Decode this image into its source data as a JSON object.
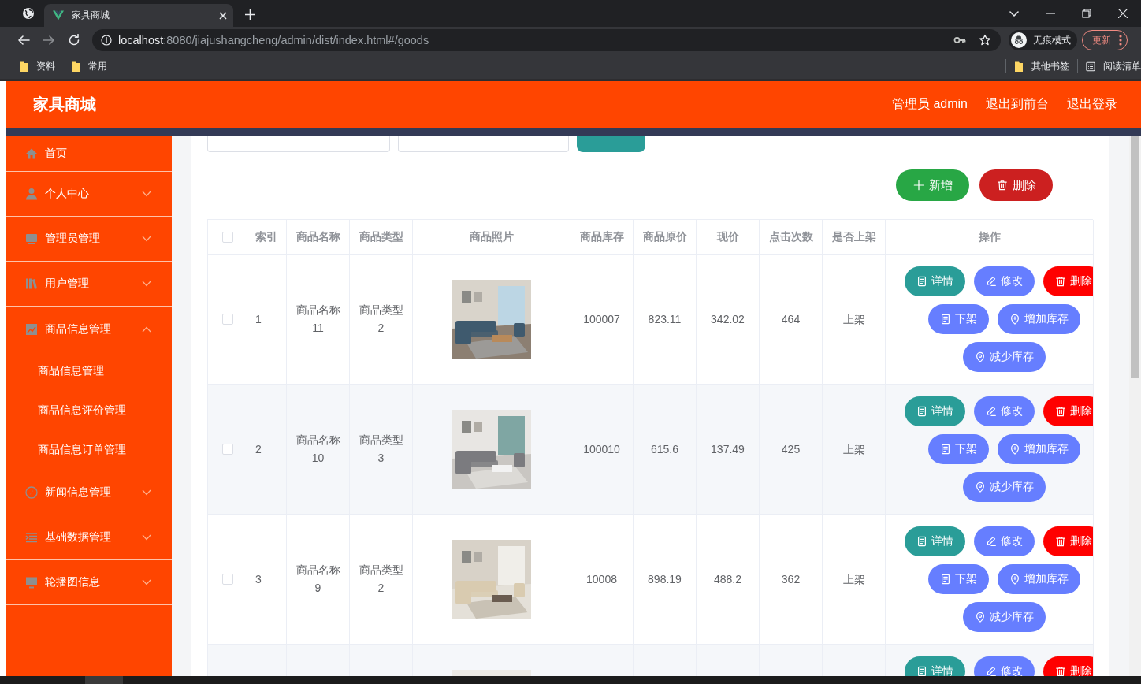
{
  "browser": {
    "tabs": [
      {
        "title": "家具商城",
        "selected": true
      }
    ],
    "url": {
      "host": "localhost",
      "path": ":8080/jiajushangcheng/admin/dist/index.html#/goods"
    },
    "profile": "无痕模式",
    "update_button": "更新",
    "bookmarks": [
      {
        "label": "资料"
      },
      {
        "label": "常用"
      }
    ],
    "bookmarks_right": [
      {
        "label": "其他书签",
        "kind": "folder"
      },
      {
        "label": "阅读清单",
        "kind": "reading-list"
      }
    ]
  },
  "header": {
    "title": "家具商城",
    "links": [
      "管理员 admin",
      "退出到前台",
      "退出登录"
    ]
  },
  "sidebar": {
    "items": [
      {
        "label": "首页"
      },
      {
        "label": "个人中心",
        "expanded": false
      },
      {
        "label": "管理员管理",
        "expanded": false
      },
      {
        "label": "用户管理",
        "expanded": false
      },
      {
        "label": "商品信息管理",
        "expanded": true,
        "children": [
          {
            "label": "商品信息管理"
          },
          {
            "label": "商品信息评价管理"
          },
          {
            "label": "商品信息订单管理"
          }
        ]
      },
      {
        "label": "新闻信息管理",
        "expanded": false
      },
      {
        "label": "基础数据管理",
        "expanded": false
      },
      {
        "label": "轮播图信息",
        "expanded": false
      }
    ]
  },
  "toolbar": {
    "buttons": [
      {
        "label": "新增",
        "kind": "add"
      },
      {
        "label": "删除",
        "kind": "delete"
      }
    ]
  },
  "table": {
    "select_all_checked": false,
    "columns": [
      "索引",
      "商品名称",
      "商品类型",
      "商品照片",
      "商品库存",
      "商品原价",
      "现价",
      "点击次数",
      "是否上架",
      "操作"
    ],
    "rows": [
      {
        "checked": false,
        "index": "1",
        "name": "商品名称11",
        "type": "商品类型2",
        "photo": {
          "kind": "picture"
        },
        "stock": "100007",
        "original_price": "823.11",
        "price": "342.02",
        "clicks": "464",
        "on_shelf": "上架",
        "actions": [
          {
            "label": "详情",
            "kind": "detail"
          },
          {
            "label": "修改",
            "kind": "edit"
          },
          {
            "label": "删除",
            "kind": "delete"
          },
          {
            "label": "下架",
            "kind": "unshelve"
          },
          {
            "label": "增加库存",
            "kind": "add-stock"
          },
          {
            "label": "减少库存",
            "kind": "reduce-stock"
          }
        ]
      },
      {
        "checked": false,
        "index": "2",
        "name": "商品名称10",
        "type": "商品类型3",
        "photo": {
          "kind": "picture"
        },
        "stock": "100010",
        "original_price": "615.6",
        "price": "137.49",
        "clicks": "425",
        "on_shelf": "上架",
        "actions": [
          {
            "label": "详情",
            "kind": "detail"
          },
          {
            "label": "修改",
            "kind": "edit"
          },
          {
            "label": "删除",
            "kind": "delete"
          },
          {
            "label": "下架",
            "kind": "unshelve"
          },
          {
            "label": "增加库存",
            "kind": "add-stock"
          },
          {
            "label": "减少库存",
            "kind": "reduce-stock"
          }
        ]
      },
      {
        "checked": false,
        "index": "3",
        "name": "商品名称9",
        "type": "商品类型2",
        "photo": {
          "kind": "picture"
        },
        "stock": "10008",
        "original_price": "898.19",
        "price": "488.2",
        "clicks": "362",
        "on_shelf": "上架",
        "actions": [
          {
            "label": "详情",
            "kind": "detail"
          },
          {
            "label": "修改",
            "kind": "edit"
          },
          {
            "label": "删除",
            "kind": "delete"
          },
          {
            "label": "下架",
            "kind": "unshelve"
          },
          {
            "label": "增加库存",
            "kind": "add-stock"
          },
          {
            "label": "减少库存",
            "kind": "reduce-stock"
          }
        ]
      },
      {
        "photo": {
          "kind": "picture"
        },
        "actions": [
          {
            "label": "详情",
            "kind": "detail"
          },
          {
            "label": "修改",
            "kind": "edit"
          },
          {
            "label": "删除",
            "kind": "delete"
          }
        ]
      }
    ]
  }
}
